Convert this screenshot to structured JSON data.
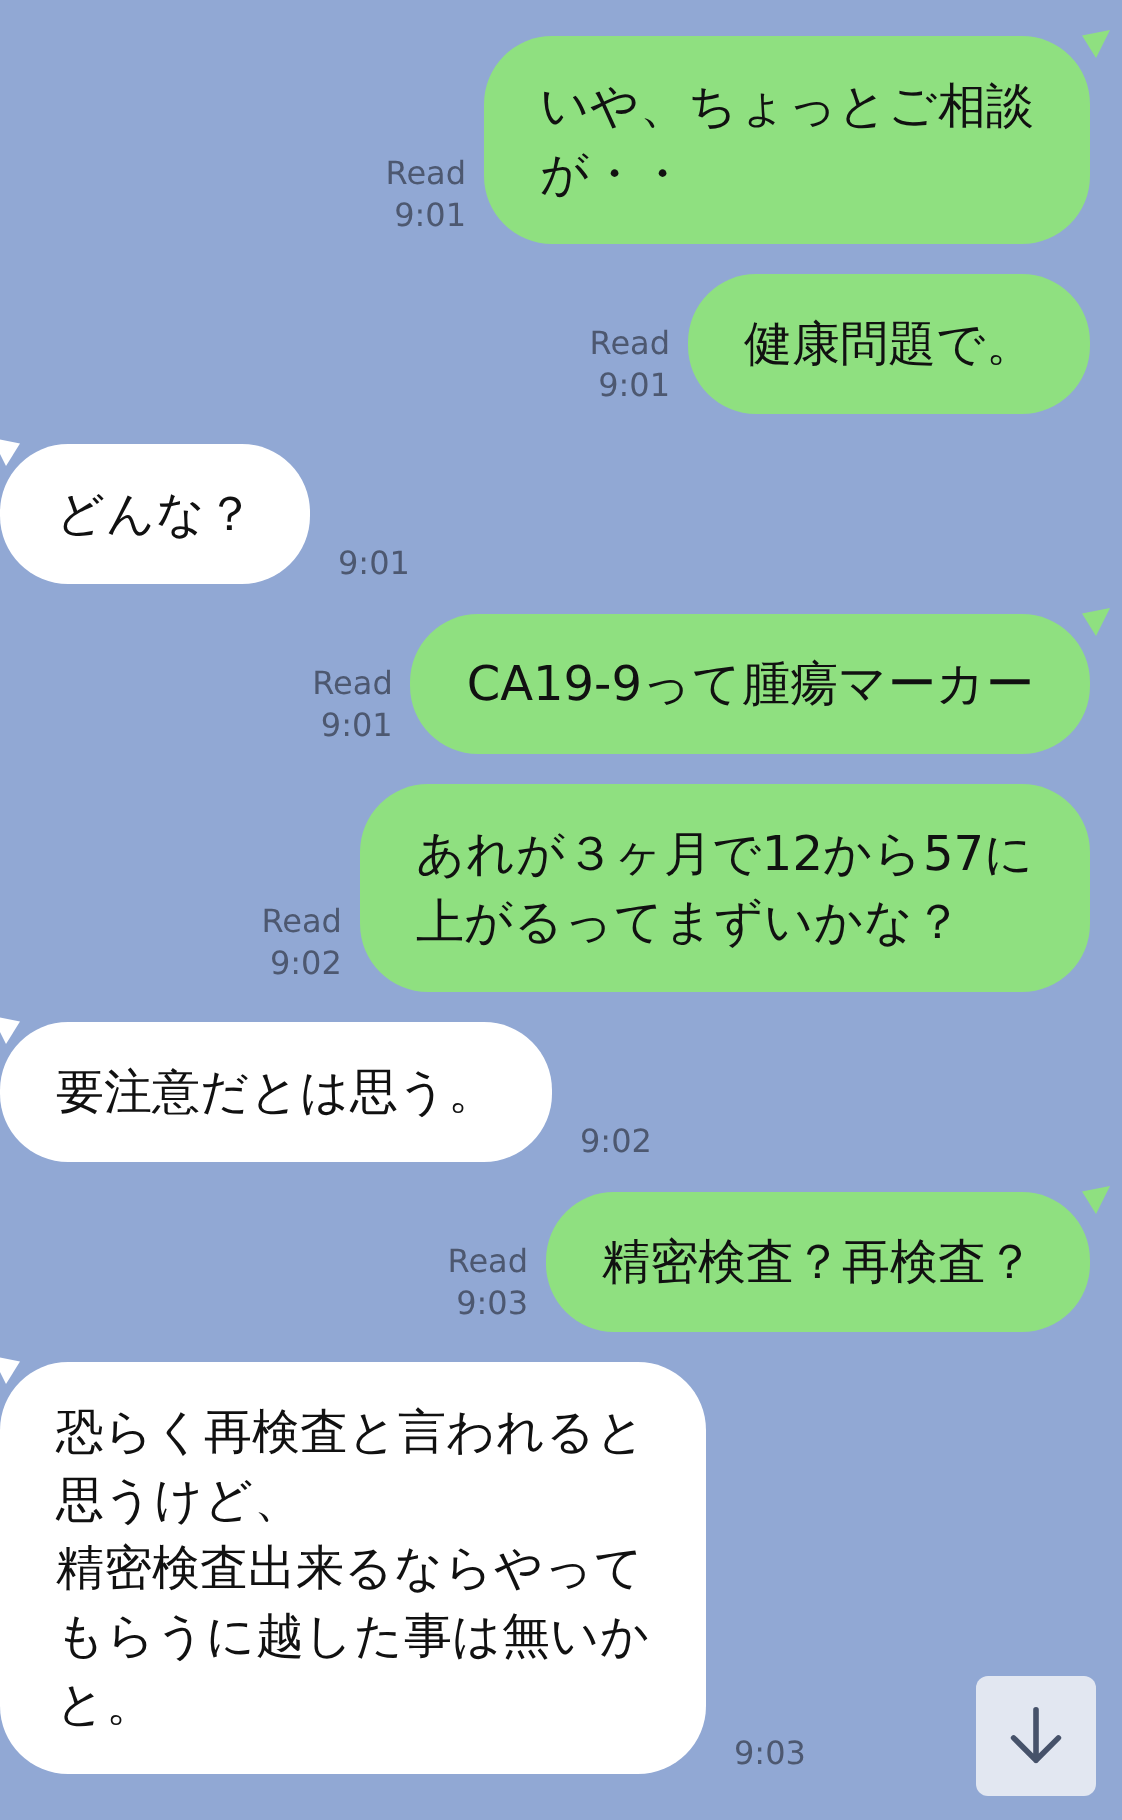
{
  "messages": [
    {
      "kind": "sent",
      "lines": [
        "いや、ちょっとご相談",
        "が・・"
      ],
      "read": "Read",
      "time": "9:01",
      "tail": true
    },
    {
      "kind": "sent",
      "lines": [
        "健康問題で。"
      ],
      "read": "Read",
      "time": "9:01",
      "tail": false
    },
    {
      "kind": "received",
      "lines": [
        "どんな？"
      ],
      "time": "9:01",
      "tail": true
    },
    {
      "kind": "sent",
      "lines": [
        "CA19-9って腫瘍マーカー"
      ],
      "read": "Read",
      "time": "9:01",
      "tail": true
    },
    {
      "kind": "sent",
      "lines": [
        "あれが３ヶ月で12から57に",
        "上がるってまずいかな？"
      ],
      "read": "Read",
      "time": "9:02",
      "tail": false
    },
    {
      "kind": "received",
      "lines": [
        "要注意だとは思う。"
      ],
      "time": "9:02",
      "tail": true
    },
    {
      "kind": "sent",
      "lines": [
        "精密検査？再検査？"
      ],
      "read": "Read",
      "time": "9:03",
      "tail": true
    },
    {
      "kind": "received",
      "lines": [
        "恐らく再検査と言われると",
        "思うけど、",
        "精密検査出来るならやって",
        "もらうに越した事は無いか",
        "と。"
      ],
      "time": "9:03",
      "tail": true
    }
  ],
  "scroll_button": {
    "visible": true
  }
}
